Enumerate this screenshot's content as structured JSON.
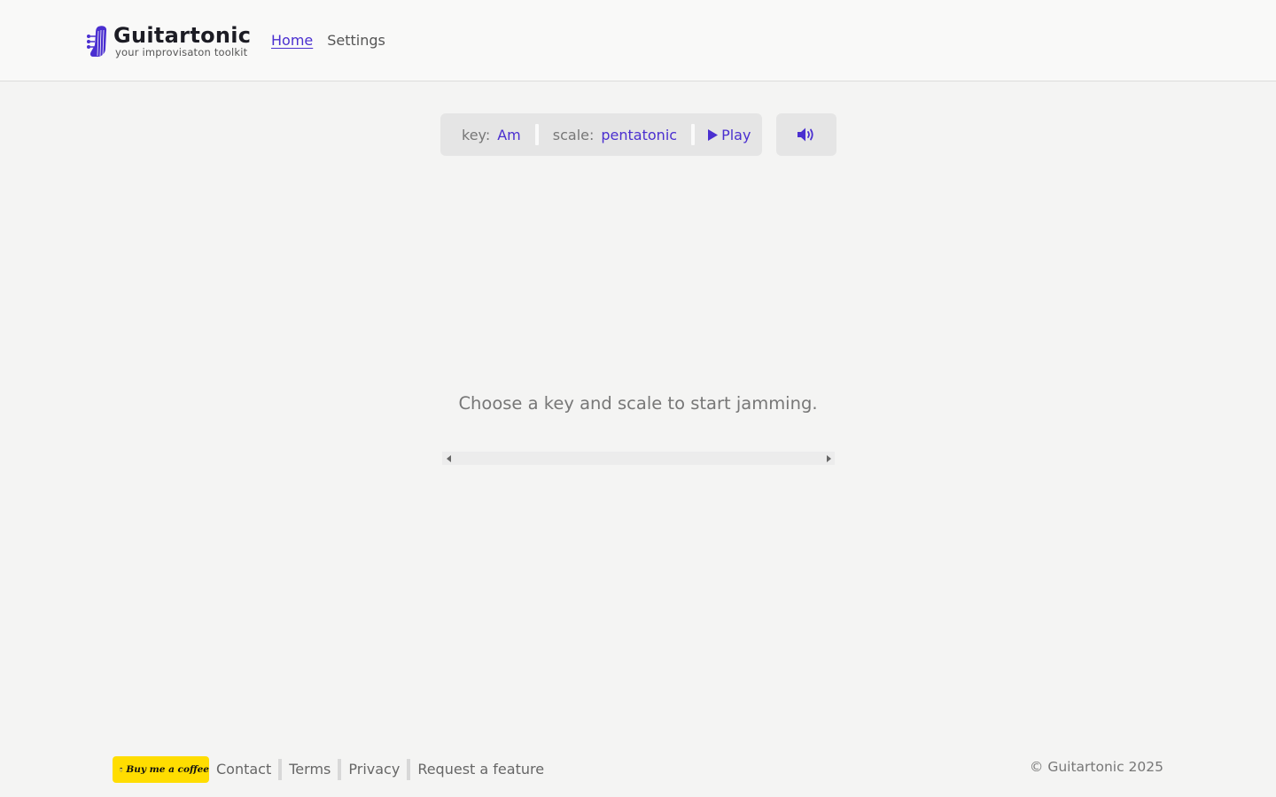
{
  "brand": {
    "title": "Guitartonic",
    "subtitle": "your improvisaton toolkit",
    "accent_color": "#4a2fd0"
  },
  "nav": {
    "items": [
      {
        "label": "Home",
        "active": true
      },
      {
        "label": "Settings",
        "active": false
      }
    ]
  },
  "controls": {
    "key_label": "key:",
    "key_value": "Am",
    "scale_label": "scale:",
    "scale_value": "pentatonic",
    "play_label": "Play",
    "play_icon": "play-icon",
    "volume_icon": "volume-icon"
  },
  "main": {
    "message": "Choose a key and scale to start jamming."
  },
  "footer": {
    "bmc_label": "Buy me a coffee",
    "bmc_color": "#ffdd00",
    "links": [
      "Contact",
      "Terms",
      "Privacy",
      "Request a feature"
    ],
    "copyright": "© Guitartonic 2025"
  }
}
